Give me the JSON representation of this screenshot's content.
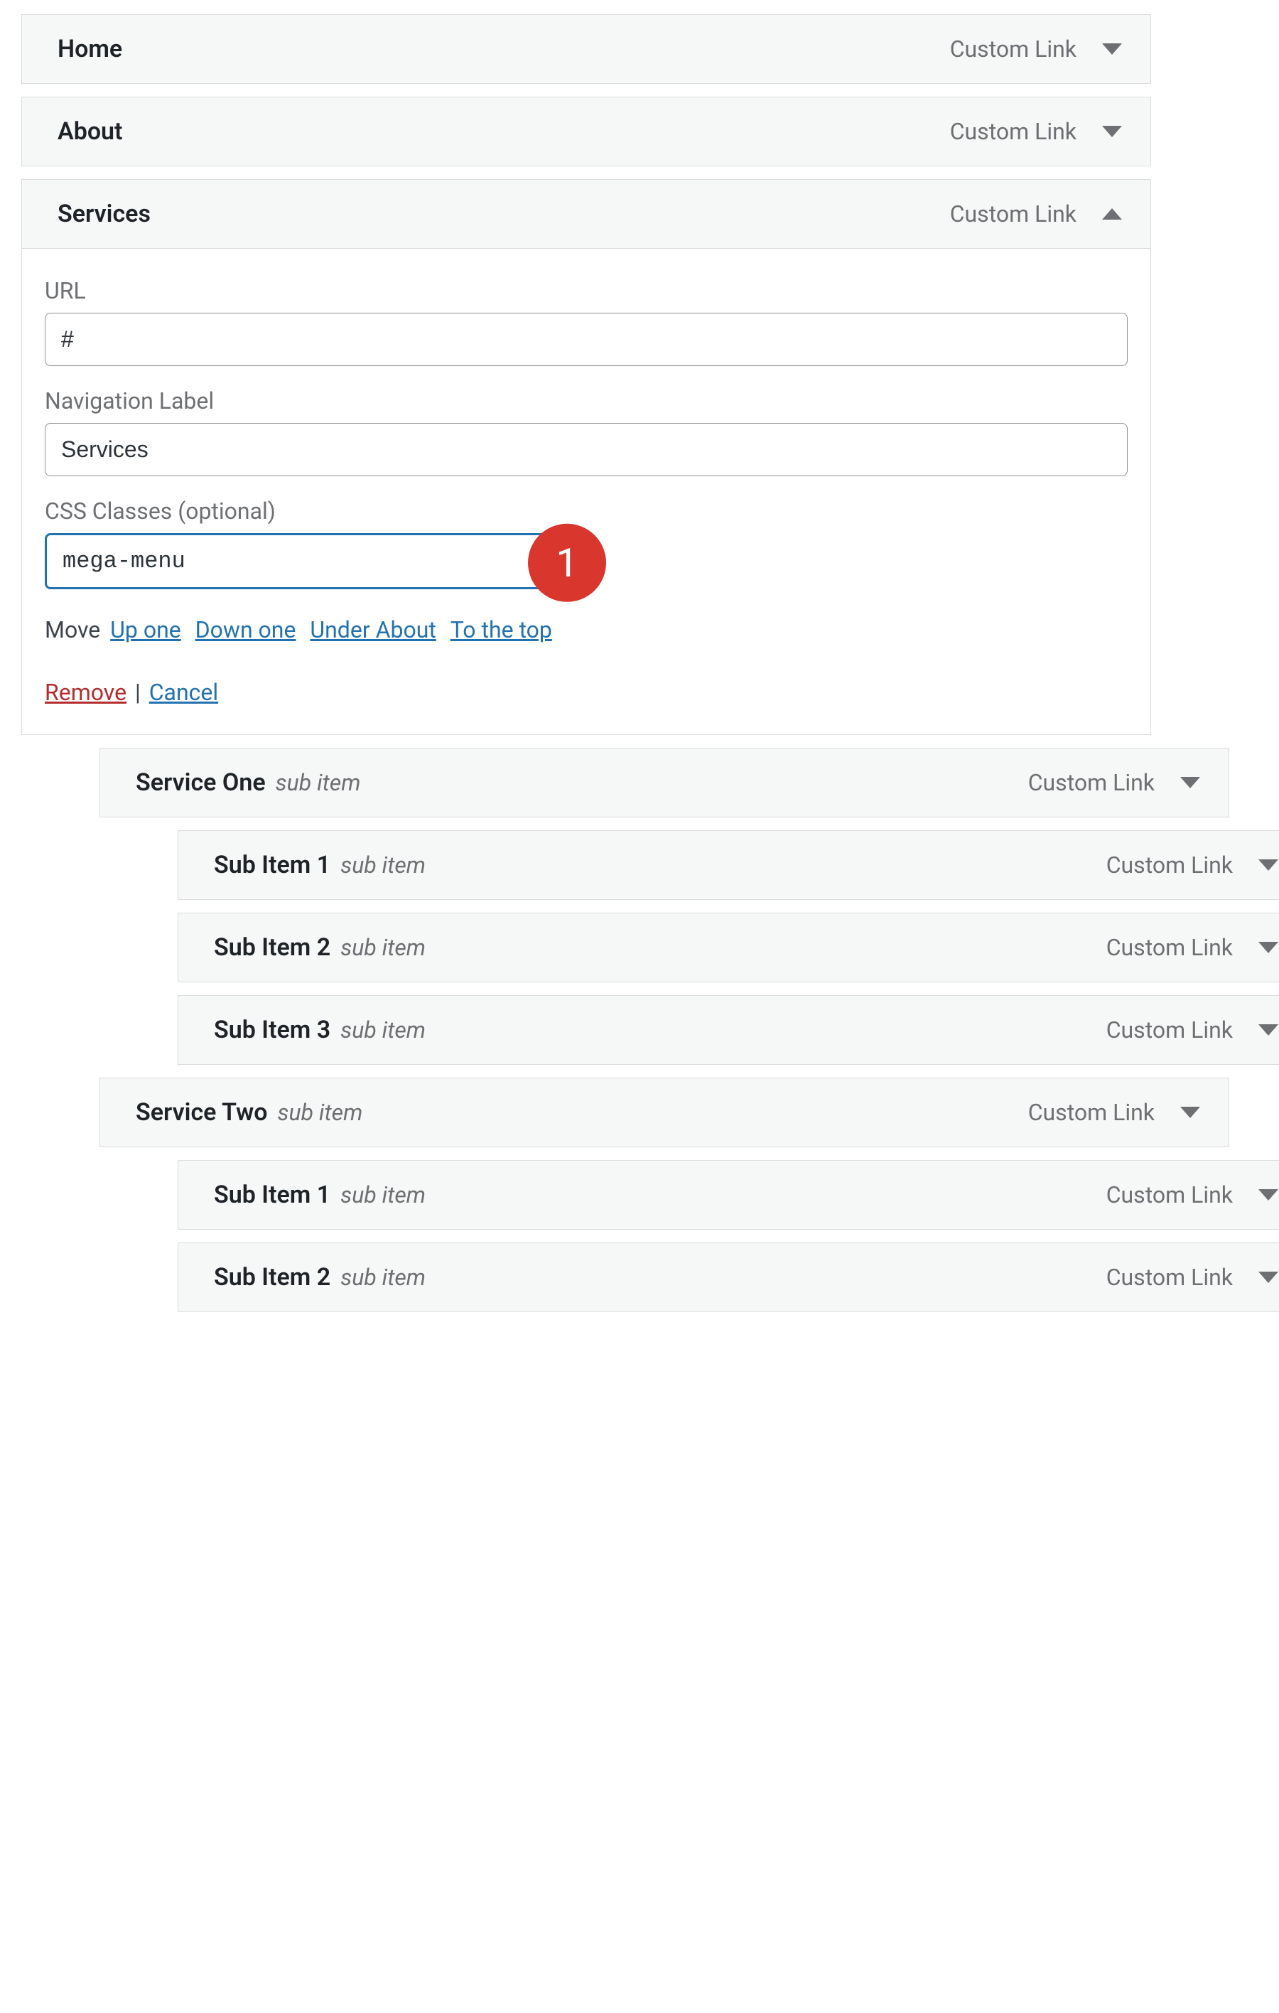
{
  "items": [
    {
      "title": "Home",
      "type": "Custom Link",
      "depth": 0,
      "expanded": false,
      "sub": ""
    },
    {
      "title": "About",
      "type": "Custom Link",
      "depth": 0,
      "expanded": false,
      "sub": ""
    },
    {
      "title": "Services",
      "type": "Custom Link",
      "depth": 0,
      "expanded": true,
      "sub": ""
    },
    {
      "title": "Service One",
      "type": "Custom Link",
      "depth": 1,
      "expanded": false,
      "sub": "sub item"
    },
    {
      "title": "Sub Item 1",
      "type": "Custom Link",
      "depth": 2,
      "expanded": false,
      "sub": "sub item"
    },
    {
      "title": "Sub Item 2",
      "type": "Custom Link",
      "depth": 2,
      "expanded": false,
      "sub": "sub item"
    },
    {
      "title": "Sub Item 3",
      "type": "Custom Link",
      "depth": 2,
      "expanded": false,
      "sub": "sub item"
    },
    {
      "title": "Service Two",
      "type": "Custom Link",
      "depth": 1,
      "expanded": false,
      "sub": "sub item"
    },
    {
      "title": "Sub Item 1",
      "type": "Custom Link",
      "depth": 2,
      "expanded": false,
      "sub": "sub item"
    },
    {
      "title": "Sub Item 2",
      "type": "Custom Link",
      "depth": 2,
      "expanded": false,
      "sub": "sub item"
    }
  ],
  "settings": {
    "url_label": "URL",
    "url_value": "#",
    "nav_label": "Navigation Label",
    "nav_value": "Services",
    "css_label": "CSS Classes (optional)",
    "css_value": "mega-menu",
    "annotation": "1",
    "move_label": "Move",
    "move_up": "Up one",
    "move_down": "Down one",
    "move_under": "Under About",
    "move_top": "To the top",
    "remove": "Remove",
    "separator": "|",
    "cancel": "Cancel"
  }
}
